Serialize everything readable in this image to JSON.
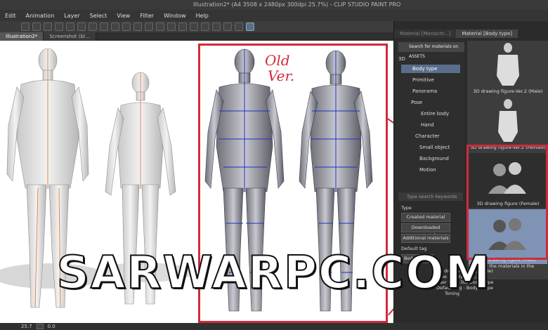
{
  "window": {
    "title": "Illustration2* (A4 3508 x 2480px 300dpi 25.7%) - CLIP STUDIO PAINT PRO"
  },
  "menu": [
    "Edit",
    "Animation",
    "Layer",
    "Select",
    "View",
    "Filter",
    "Window",
    "Help"
  ],
  "tabs": [
    {
      "label": "Illustration2*"
    },
    {
      "label": "Screenshot (bl..."
    }
  ],
  "annotation": {
    "text_line1": "Old",
    "text_line2": "Ver."
  },
  "watermark": "SARWARPC.COM",
  "panel": {
    "tab_inactive": "Material [Monochr...]",
    "tab_active": "Material [Body type]",
    "search_assets": "Search for materials on ASSETS",
    "tree": [
      {
        "label": "3D"
      },
      {
        "label": "Body type"
      },
      {
        "label": "Primitive"
      },
      {
        "label": "Panorama"
      },
      {
        "label": "Pose"
      },
      {
        "label": "Entire body"
      },
      {
        "label": "Hand"
      },
      {
        "label": "Character"
      },
      {
        "label": "Small object"
      },
      {
        "label": "Background"
      },
      {
        "label": "Motion"
      }
    ],
    "thumbs": [
      {
        "caption": "3D drawing figure-Ver.2 (Male)"
      },
      {
        "caption": "3D drawing figure-Ver.2 (Female)"
      },
      {
        "caption": "3D drawing figure (Female)"
      },
      {
        "caption": "3D drawing figure (Male)"
      }
    ],
    "tag_search_placeholder": "Type search keywords",
    "type_label": "Type",
    "buttons": [
      "Created material",
      "Downloaded material",
      "Additional materials"
    ],
    "default_tag_label": "Default tag",
    "body_shape_tag": "Body shape",
    "show_all": "Show all the materials in the subfol...",
    "info_name": "3D drawing figure (Male)",
    "info_type": "Type : Body sha...",
    "info_usertag": "User tag : 3D, Body_type",
    "info_defaulttag": "Default tag : Body shape",
    "info_toning": "Toning"
  },
  "status": {
    "zoom": "25.7",
    "angle": "0.0"
  }
}
